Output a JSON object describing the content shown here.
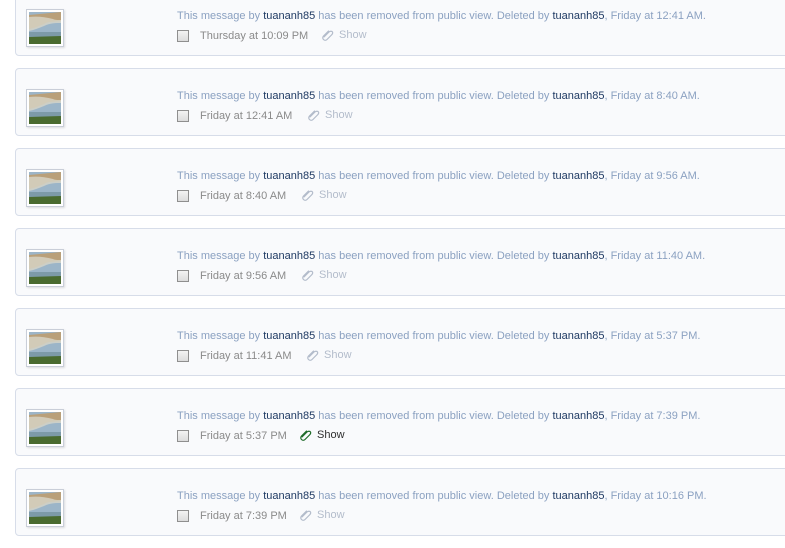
{
  "messages": [
    {
      "notice_prefix": "This message by",
      "author": "tuananh85",
      "notice_mid": "has been removed from public view. Deleted by",
      "deleted_by": "tuananh85",
      "deleted_time": ", Friday at 12:41 AM.",
      "timestamp": "Thursday at 10:09 PM",
      "show_label": "Show",
      "show_active": false
    },
    {
      "notice_prefix": "This message by",
      "author": "tuananh85",
      "notice_mid": "has been removed from public view. Deleted by",
      "deleted_by": "tuananh85",
      "deleted_time": ", Friday at 8:40 AM.",
      "timestamp": "Friday at 12:41 AM",
      "show_label": "Show",
      "show_active": false
    },
    {
      "notice_prefix": "This message by",
      "author": "tuananh85",
      "notice_mid": "has been removed from public view. Deleted by",
      "deleted_by": "tuananh85",
      "deleted_time": ", Friday at 9:56 AM.",
      "timestamp": "Friday at 8:40 AM",
      "show_label": "Show",
      "show_active": false
    },
    {
      "notice_prefix": "This message by",
      "author": "tuananh85",
      "notice_mid": "has been removed from public view. Deleted by",
      "deleted_by": "tuananh85",
      "deleted_time": ", Friday at 11:40 AM.",
      "timestamp": "Friday at 9:56 AM",
      "show_label": "Show",
      "show_active": false
    },
    {
      "notice_prefix": "This message by",
      "author": "tuananh85",
      "notice_mid": "has been removed from public view. Deleted by",
      "deleted_by": "tuananh85",
      "deleted_time": ", Friday at 5:37 PM.",
      "timestamp": "Friday at 11:41 AM",
      "show_label": "Show",
      "show_active": false
    },
    {
      "notice_prefix": "This message by",
      "author": "tuananh85",
      "notice_mid": "has been removed from public view. Deleted by",
      "deleted_by": "tuananh85",
      "deleted_time": ", Friday at 7:39 PM.",
      "timestamp": "Friday at 5:37 PM",
      "show_label": "Show",
      "show_active": true
    },
    {
      "notice_prefix": "This message by",
      "author": "tuananh85",
      "notice_mid": "has been removed from public view. Deleted by",
      "deleted_by": "tuananh85",
      "deleted_time": ", Friday at 10:16 PM.",
      "timestamp": "Friday at 7:39 PM",
      "show_label": "Show",
      "show_active": false
    }
  ],
  "colors": {
    "notice_text": "#8ba1c1",
    "username": "#1f3a63",
    "timestamp": "#8a8a8a",
    "show_inactive": "#b3bccb",
    "show_active": "#2f2f2f",
    "card_background": "#f9fafc",
    "card_border": "#d7dde9"
  },
  "icons": {
    "avatar": "landscape-avatar",
    "show": "paperclip-icon"
  }
}
